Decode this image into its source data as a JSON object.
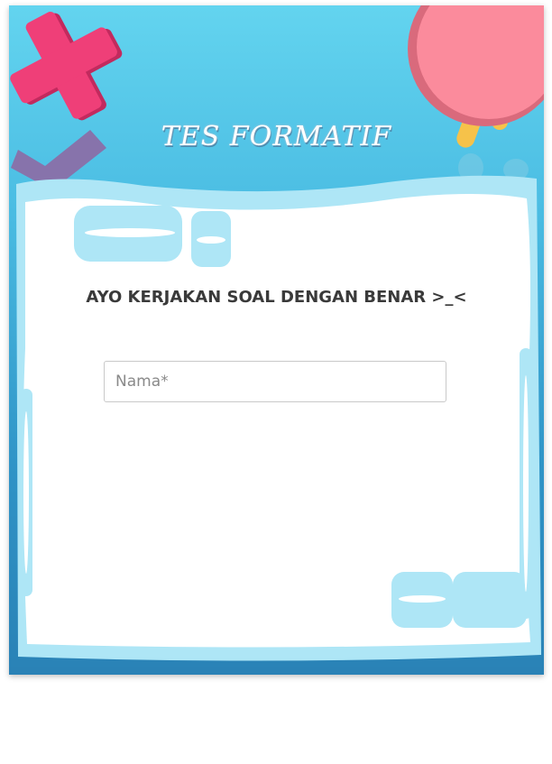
{
  "form": {
    "title": "TES FORMATIF",
    "subtitle": "AYO KERJAKAN SOAL DENGAN BENAR >_<",
    "name_field": {
      "placeholder": "Nama*",
      "value": ""
    }
  },
  "colors": {
    "sky_top": "#63d4ef",
    "sky_bottom": "#2a82b6",
    "paper": "#ffffff",
    "paper_border": "#aee6f6",
    "plus_shape": "#ef3f78",
    "circle_shape": "#fb8b9c",
    "stick_shape": "#f6c24a",
    "check_shape": "#8a6fa8"
  },
  "decorations": [
    "plus-icon",
    "check-icon",
    "pink-circle",
    "yellow-stick"
  ]
}
